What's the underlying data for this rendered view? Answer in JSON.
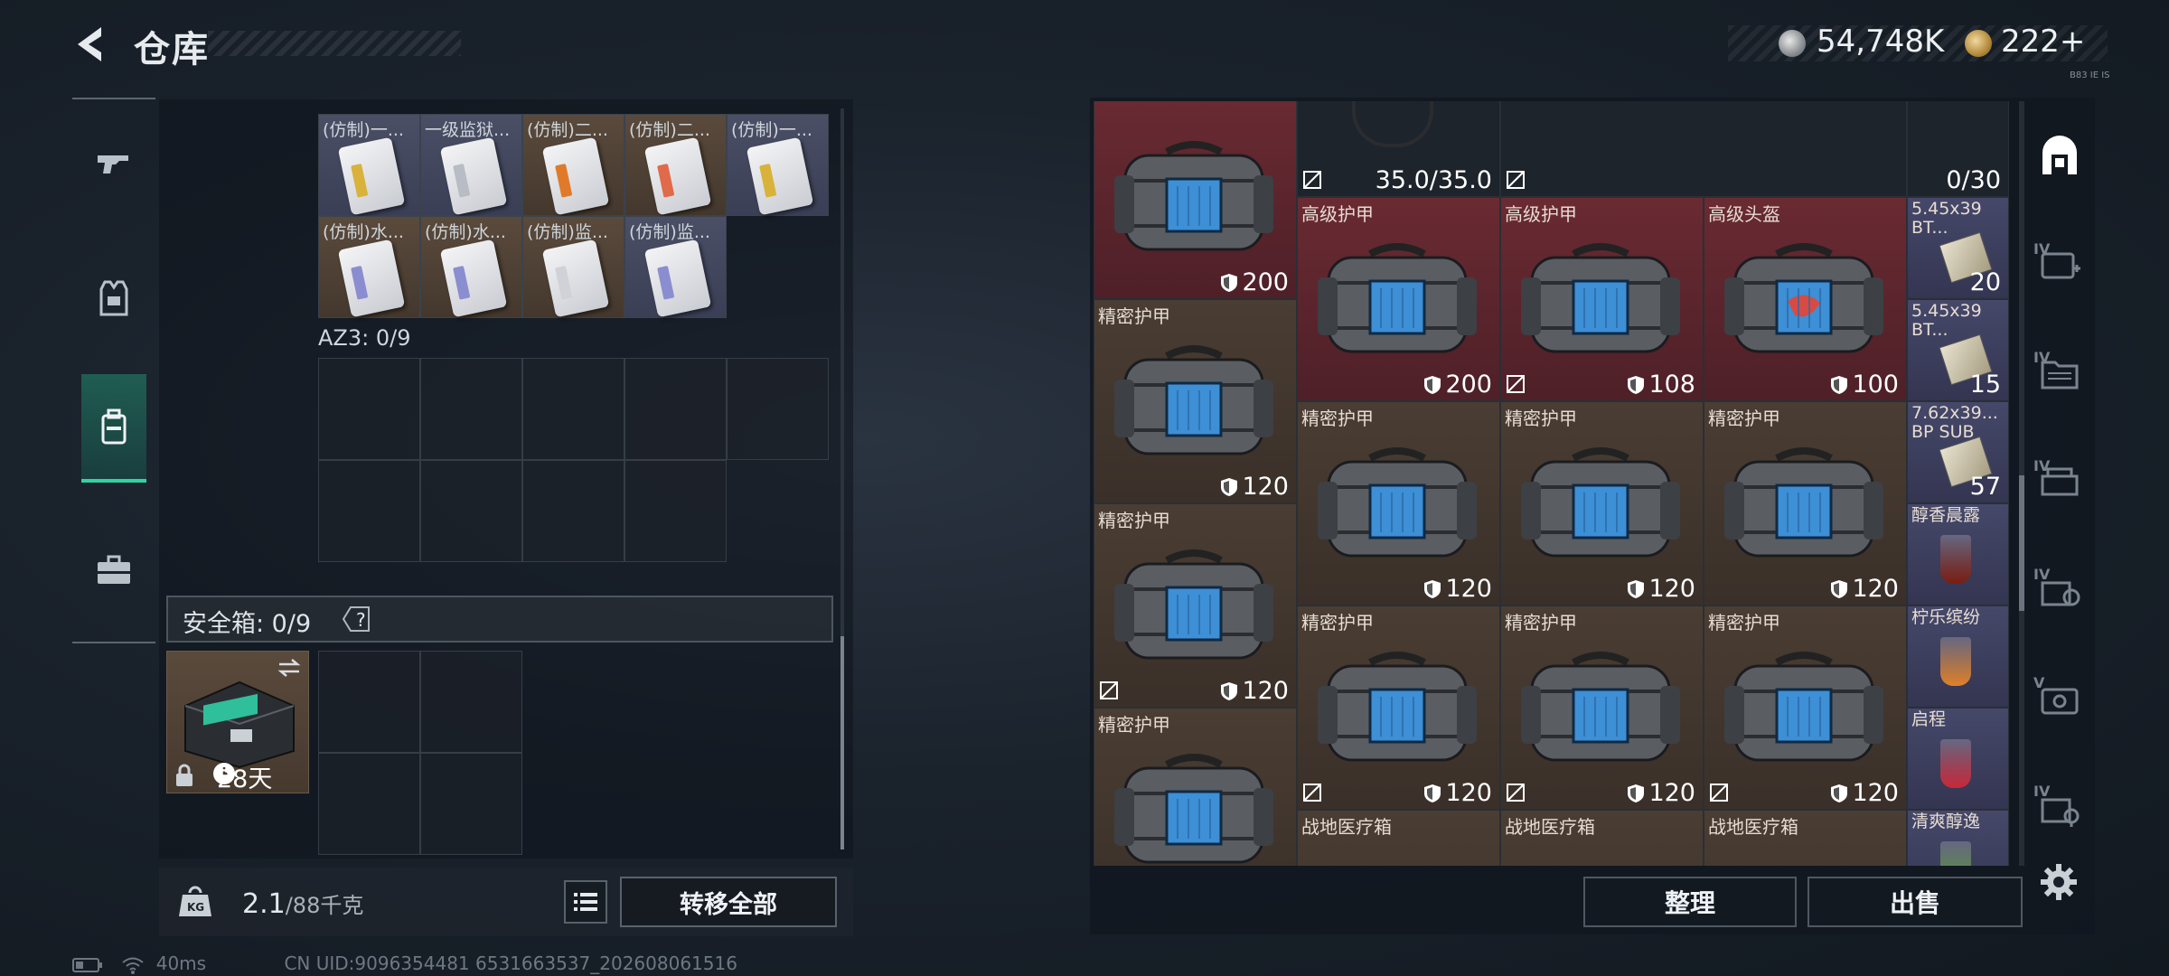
{
  "header": {
    "title": "仓库",
    "currency_1": "54,748K",
    "currency_2": "222+",
    "tiny_tag": "B83 IE IS"
  },
  "left_nav": {
    "items": [
      "weapon-icon",
      "armor-icon",
      "container-icon",
      "case-icon"
    ],
    "active_index": 2
  },
  "container": {
    "row1": [
      {
        "label": "(仿制)一...",
        "color": "purple",
        "stripe": "#d8b23a"
      },
      {
        "label": "一级监狱...",
        "color": "purple",
        "stripe": "#b8bcc4"
      },
      {
        "label": "(仿制)二...",
        "color": "brown",
        "stripe": "#e07a2a"
      },
      {
        "label": "(仿制)二...",
        "color": "brown",
        "stripe": "#e06a4a"
      },
      {
        "label": "(仿制)一...",
        "color": "purple",
        "stripe": "#d8b23a"
      }
    ],
    "row2": [
      {
        "label": "(仿制)水...",
        "color": "brown",
        "stripe": "#8a8ed0"
      },
      {
        "label": "(仿制)水...",
        "color": "brown",
        "stripe": "#8a8ed0"
      },
      {
        "label": "(仿制)监...",
        "color": "brown",
        "stripe": "#d0d2d8"
      },
      {
        "label": "(仿制)监...",
        "color": "purple",
        "stripe": "#8a8ed0"
      }
    ],
    "az3_label": "AZ3: 0/9"
  },
  "safe_box": {
    "label": "安全箱:  0/9",
    "help": "?",
    "time_left": "28天"
  },
  "weight": {
    "current": "2.1",
    "max": "/88千克",
    "kg_label": "KG"
  },
  "buttons": {
    "transfer_all": "转移全部",
    "sort": "整理",
    "sell": "出售"
  },
  "status": {
    "ping": "40ms",
    "uid": "CN UID:9096354481 6531663537_202608061516"
  },
  "stash": {
    "top_partial": [
      {
        "name": "高级护甲",
        "value": "",
        "bg": "red"
      },
      {
        "name": "",
        "value": "35.0/35.0",
        "bg": "dark"
      },
      {
        "name": "",
        "value": "",
        "bg": "dark"
      },
      {
        "name": "",
        "value": "0/30",
        "bg": "dark"
      }
    ],
    "items": [
      {
        "name": "",
        "value": "200",
        "bg": "red"
      },
      {
        "name": "高级护甲",
        "value": "200",
        "bg": "red"
      },
      {
        "name": "高级护甲",
        "value": "108",
        "bg": "red"
      },
      {
        "name": "高级头盔",
        "value": "100",
        "bg": "red"
      },
      {
        "name": "精密护甲",
        "value": "120",
        "bg": "brown"
      },
      {
        "name": "精密护甲",
        "value": "120",
        "bg": "brown"
      },
      {
        "name": "精密护甲",
        "value": "120",
        "bg": "brown"
      },
      {
        "name": "精密护甲",
        "value": "120",
        "bg": "brown"
      },
      {
        "name": "精密护甲",
        "value": "120",
        "bg": "brown"
      },
      {
        "name": "精密护甲",
        "value": "120",
        "bg": "brown"
      },
      {
        "name": "精密护甲",
        "value": "120",
        "bg": "brown"
      },
      {
        "name": "精密护甲",
        "value": "120",
        "bg": "brown"
      },
      {
        "name": "精密护甲",
        "value": "120",
        "bg": "brown"
      },
      {
        "name": "精密护甲",
        "value": "120",
        "bg": "brown"
      },
      {
        "name": "精密护甲",
        "value": "",
        "bg": "brown"
      },
      {
        "name": "战地医疗箱",
        "value": "",
        "bg": "brown"
      },
      {
        "name": "战地医疗箱",
        "value": "",
        "bg": "brown"
      },
      {
        "name": "战地医疗箱",
        "value": "",
        "bg": "brown"
      }
    ],
    "side_column": [
      {
        "name": "5.45x39 BT...",
        "count": "20"
      },
      {
        "name": "5.45x39 BT...",
        "count": "15"
      },
      {
        "name": "7.62x39... BP SUB",
        "count": "57"
      },
      {
        "name": "醇香晨露",
        "count": ""
      },
      {
        "name": "柠乐缤纷",
        "count": ""
      },
      {
        "name": "启程",
        "count": ""
      },
      {
        "name": "清爽醇逸",
        "count": ""
      }
    ]
  },
  "right_nav": {
    "items": [
      "home-icon",
      "med-icon",
      "folder-icon",
      "ammo-icon",
      "gear-box-icon",
      "screen-icon",
      "key-icon"
    ],
    "labels": [
      "",
      "IV",
      "IV",
      "IV",
      "IV",
      "V",
      "IV"
    ]
  },
  "colors": {
    "accent": "#2fd4a1",
    "red_item": "#6a2a32",
    "brown_item": "#4a3d33",
    "purple_item": "#46486a"
  }
}
